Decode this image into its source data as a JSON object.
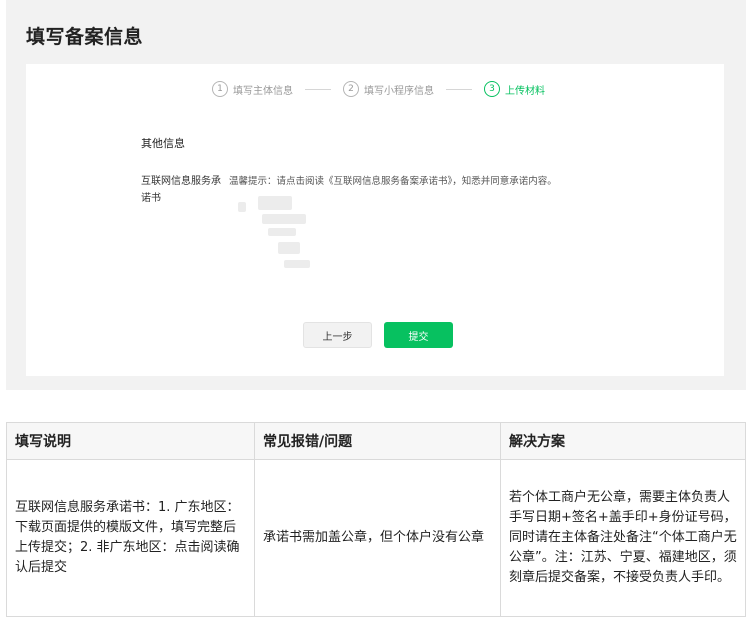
{
  "page": {
    "title": "填写备案信息"
  },
  "steps": [
    {
      "num": "1",
      "label": "填写主体信息",
      "active": false
    },
    {
      "num": "2",
      "label": "填写小程序信息",
      "active": false
    },
    {
      "num": "3",
      "label": "上传材料",
      "active": true
    }
  ],
  "form": {
    "section_title": "其他信息",
    "row_label": "互联网信息服务承诺书",
    "row_hint": "温馨提示：请点击阅读《互联网信息服务备案承诺书》，知悉并同意承诺内容。",
    "prev_button": "上一步",
    "submit_button": "提交"
  },
  "help_table": {
    "headers": [
      "填写说明",
      "常见报错/问题",
      "解决方案"
    ],
    "rows": [
      {
        "instruction": "互联网信息服务承诺书：1. 广东地区：下载页面提供的模版文件，填写完整后上传提交；2. 非广东地区：点击阅读确认后提交",
        "issue": "承诺书需加盖公章，但个体户没有公章",
        "solution": "若个体工商户无公章，需要主体负责人手写日期+签名+盖手印+身份证号码，同时请在主体备注处备注“个体工商户无公章”。注：江苏、宁夏、福建地区，须刻章后提交备案，不接受负责人手印。"
      }
    ]
  },
  "colors": {
    "accent": "#07c160",
    "panel_bg": "#f2f2f2"
  }
}
